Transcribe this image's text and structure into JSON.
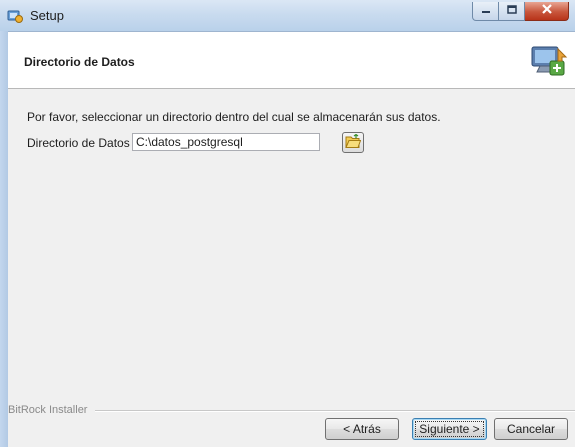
{
  "window": {
    "title": "Setup",
    "icon": "setup-app-icon",
    "caption_buttons": [
      "minimize-icon",
      "maximize-icon",
      "close-icon"
    ]
  },
  "header": {
    "title": "Directorio de Datos",
    "icon": "computer-install-icon"
  },
  "main": {
    "instruction": "Por favor, seleccionar un directorio dentro del cual se almacenarán sus datos.",
    "directory_label": "Directorio de Datos",
    "directory_value": "C:\\datos_postgresql",
    "browse_icon": "folder-open-icon"
  },
  "footer": {
    "installer_label": "BitRock Installer",
    "back_label": "< Atrás",
    "next_label": "Siguiente >",
    "cancel_label": "Cancelar"
  },
  "colors": {
    "titlebar": "#c9dbef",
    "close_button": "#c8563c",
    "window_bg": "#f0f0f0",
    "header_bg": "#ffffff"
  }
}
